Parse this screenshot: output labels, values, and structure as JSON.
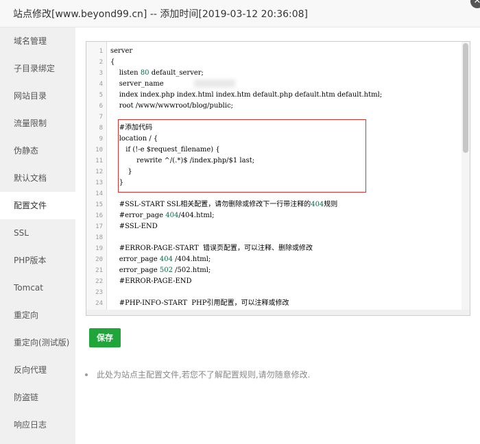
{
  "dialog": {
    "title": "站点修改[www.beyond99.cn] -- 添加时间[2019-03-12 20:36:08]",
    "close_symbol": "✕"
  },
  "sidebar": {
    "items": [
      {
        "label": "域名管理"
      },
      {
        "label": "子目录绑定"
      },
      {
        "label": "网站目录"
      },
      {
        "label": "流量限制"
      },
      {
        "label": "伪静态"
      },
      {
        "label": "默认文档"
      },
      {
        "label": "配置文件",
        "active": true
      },
      {
        "label": "SSL"
      },
      {
        "label": "PHP版本"
      },
      {
        "label": "Tomcat"
      },
      {
        "label": "重定向"
      },
      {
        "label": "重定向(测试版)"
      },
      {
        "label": "反向代理"
      },
      {
        "label": "防盗链"
      },
      {
        "label": "响应日志"
      }
    ]
  },
  "editor": {
    "lines": [
      {
        "n": "1",
        "text": "server"
      },
      {
        "n": "2",
        "text": "{"
      },
      {
        "n": "3",
        "text": "    listen 80 default_server;"
      },
      {
        "n": "4",
        "text": "    server_name"
      },
      {
        "n": "5",
        "text": "    index index.php index.html index.htm default.php default.htm default.html;"
      },
      {
        "n": "6",
        "text": "    root /www/wwwroot/blog/public;"
      },
      {
        "n": "7",
        "text": ""
      },
      {
        "n": "8",
        "text": "    #添加代码"
      },
      {
        "n": "9",
        "text": "    location / {"
      },
      {
        "n": "10",
        "text": "       if (!-e $request_filename) {"
      },
      {
        "n": "11",
        "text": "            rewrite ^/(.*)$ /index.php/$1 last;"
      },
      {
        "n": "12",
        "text": "        }"
      },
      {
        "n": "13",
        "text": "    }"
      },
      {
        "n": "14",
        "text": ""
      },
      {
        "n": "15",
        "text": "    #SSL-START SSL相关配置，请勿删除或修改下一行带注释的404规则"
      },
      {
        "n": "16",
        "text": "    #error_page 404/404.html;"
      },
      {
        "n": "17",
        "text": "    #SSL-END"
      },
      {
        "n": "18",
        "text": ""
      },
      {
        "n": "19",
        "text": "    #ERROR-PAGE-START  错误页配置，可以注释、删除或修改"
      },
      {
        "n": "20",
        "text": "    error_page 404 /404.html;"
      },
      {
        "n": "21",
        "text": "    error_page 502 /502.html;"
      },
      {
        "n": "22",
        "text": "    #ERROR-PAGE-END"
      },
      {
        "n": "23",
        "text": ""
      },
      {
        "n": "24",
        "text": "    #PHP-INFO-START  PHP引用配置，可以注释或修改"
      }
    ]
  },
  "actions": {
    "save_label": "保存"
  },
  "note": {
    "text": "此处为站点主配置文件,若您不了解配置规则,请勿随意修改."
  },
  "colors": {
    "save_button": "#20a53a",
    "highlight_border": "#d9302f",
    "sidebar_bg": "#f0f0f0"
  }
}
